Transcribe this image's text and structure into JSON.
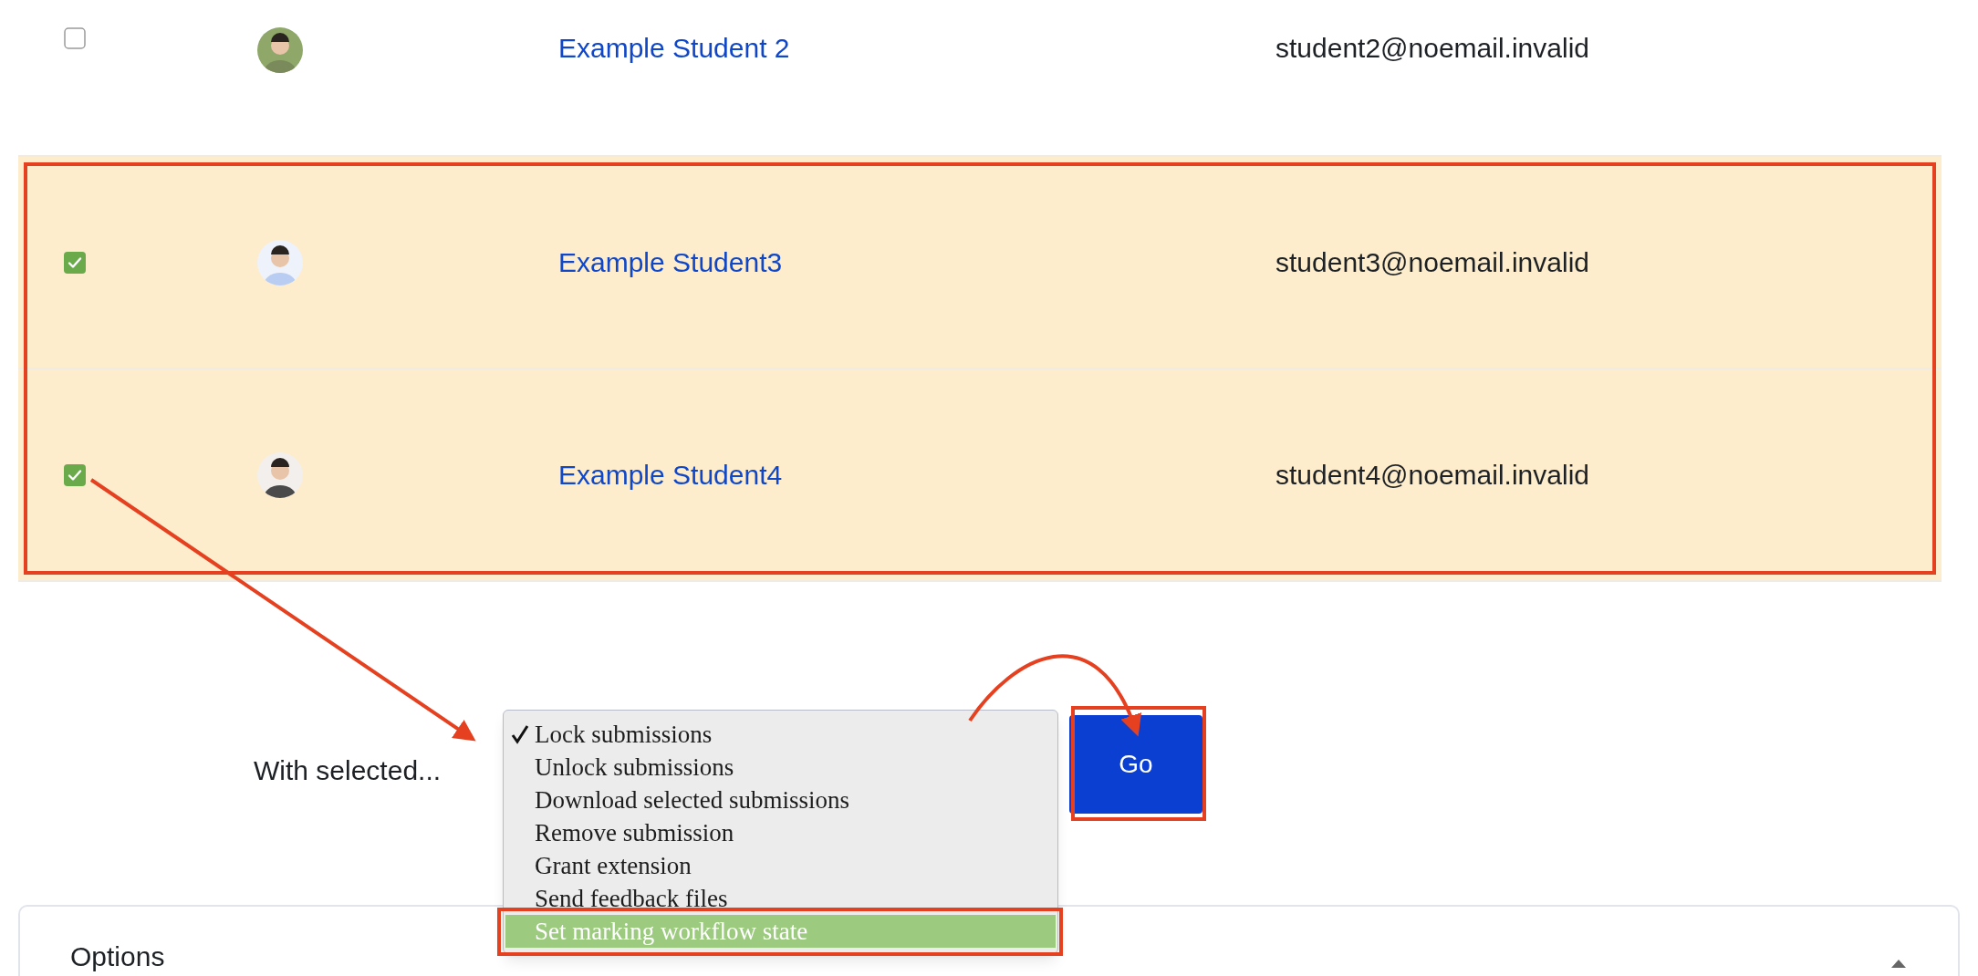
{
  "rows": [
    {
      "selected": false,
      "name": "Example Student 2",
      "email": "student2@noemail.invalid"
    },
    {
      "selected": true,
      "name": "Example Student3",
      "email": "student3@noemail.invalid"
    },
    {
      "selected": true,
      "name": "Example Student4",
      "email": "student4@noemail.invalid"
    }
  ],
  "bulk_action": {
    "label": "With selected...",
    "menu": [
      {
        "label": "Lock submissions",
        "checked": true,
        "highlighted": false
      },
      {
        "label": "Unlock submissions",
        "checked": false,
        "highlighted": false
      },
      {
        "label": "Download selected submissions",
        "checked": false,
        "highlighted": false
      },
      {
        "label": "Remove submission",
        "checked": false,
        "highlighted": false
      },
      {
        "label": "Grant extension",
        "checked": false,
        "highlighted": false
      },
      {
        "label": "Send feedback files",
        "checked": false,
        "highlighted": false
      },
      {
        "label": "Set marking workflow state",
        "checked": false,
        "highlighted": true
      }
    ],
    "button": "Go"
  },
  "options_panel": {
    "title": "Options",
    "expanded": true
  }
}
